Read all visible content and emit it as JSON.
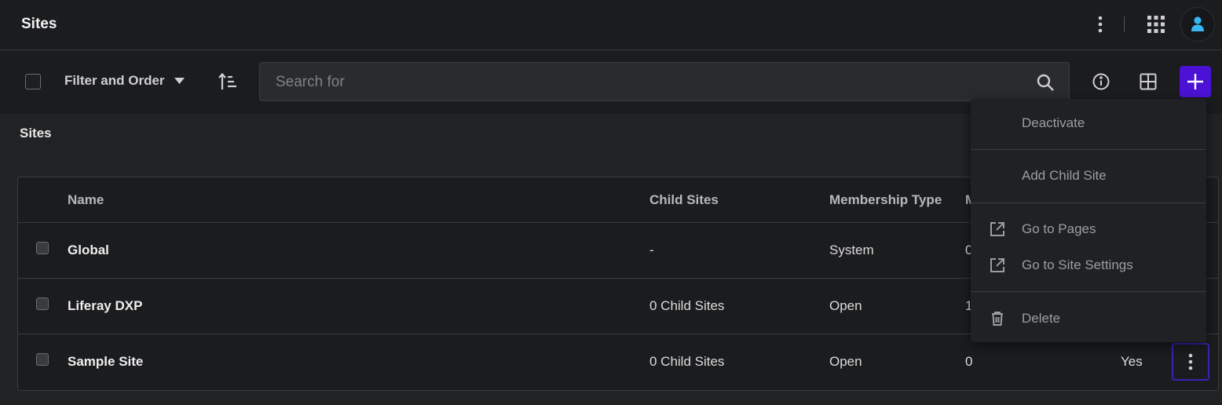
{
  "header": {
    "title": "Sites"
  },
  "toolbar": {
    "filter_label": "Filter and Order",
    "search_placeholder": "Search for",
    "accent_color": "#4b12d6"
  },
  "section": {
    "title": "Sites"
  },
  "table": {
    "columns": [
      "Name",
      "Child Sites",
      "Membership Type",
      "M"
    ],
    "rows": [
      {
        "name": "Global",
        "child_sites": "-",
        "membership": "System",
        "members": "0",
        "active": ""
      },
      {
        "name": "Liferay DXP",
        "child_sites": "0 Child Sites",
        "membership": "Open",
        "members": "1",
        "active": ""
      },
      {
        "name": "Sample Site",
        "child_sites": "0 Child Sites",
        "membership": "Open",
        "members": "0",
        "active": "Yes"
      }
    ]
  },
  "menu": {
    "items": [
      {
        "label": "Deactivate",
        "icon": ""
      },
      {
        "label": "Add Child Site",
        "icon": ""
      },
      {
        "label": "Go to Pages",
        "icon": "external-link-icon"
      },
      {
        "label": "Go to Site Settings",
        "icon": "external-link-icon"
      },
      {
        "label": "Delete",
        "icon": "trash-icon"
      }
    ]
  }
}
